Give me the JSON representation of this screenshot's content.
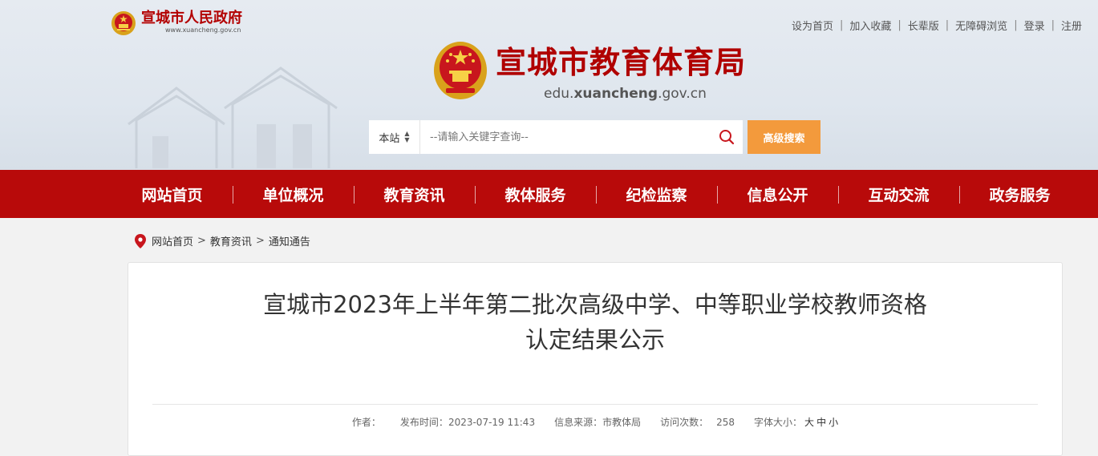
{
  "gov_portal": {
    "name": "宣城市人民政府",
    "url": "www.xuancheng.gov.cn"
  },
  "top_links": [
    "设为首页",
    "加入收藏",
    "长辈版",
    "无障碍浏览",
    "登录",
    "注册"
  ],
  "site": {
    "name": "宣城市教育体育局",
    "url_prefix": "edu.",
    "url_domain": "xuancheng",
    "url_suffix": ".gov.cn"
  },
  "search": {
    "scope": "本站",
    "placeholder": "--请输入关键字查询--",
    "advanced_label": "高级搜索"
  },
  "nav": [
    "网站首页",
    "单位概况",
    "教育资讯",
    "教体服务",
    "纪检监察",
    "信息公开",
    "互动交流",
    "政务服务"
  ],
  "breadcrumb": [
    "网站首页",
    "教育资讯",
    "通知通告"
  ],
  "article": {
    "title_line1": "宣城市2023年上半年第二批次高级中学、中等职业学校教师资格",
    "title_line2": "认定结果公示",
    "author_label": "作者：",
    "author": "",
    "published_label": "发布时间：",
    "published": "2023-07-19 11:43",
    "source_label": "信息来源：",
    "source": "市教体局",
    "views_label": "访问次数：",
    "views": "258",
    "font_size_label": "字体大小：",
    "font_sizes": [
      "大",
      "中",
      "小"
    ]
  },
  "colors": {
    "brand_red": "#b80a0a",
    "accent_orange": "#f39a3c"
  }
}
